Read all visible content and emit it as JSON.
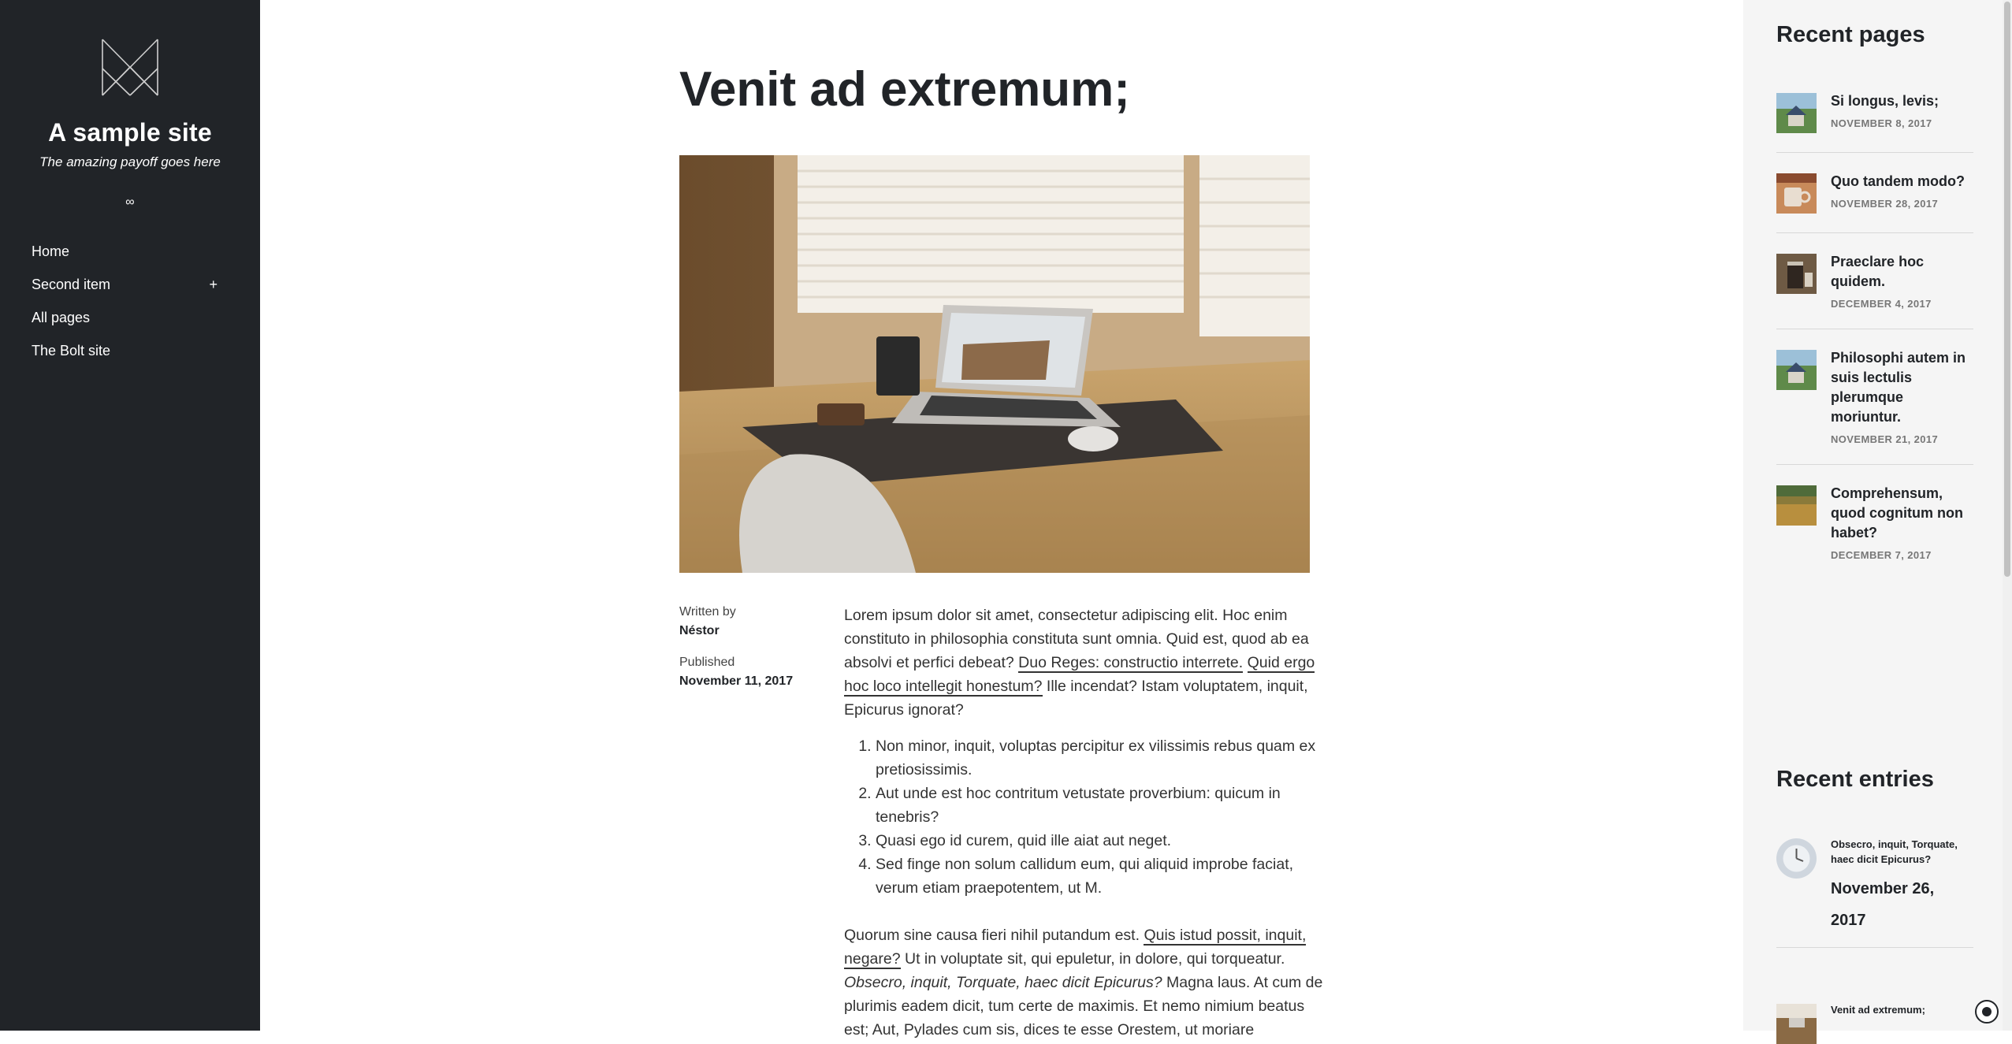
{
  "sidebar": {
    "site_title": "A sample site",
    "payoff": "The amazing payoff goes here",
    "separator": "∞",
    "logo_icon": "monogram-logo",
    "nav": [
      {
        "label": "Home"
      },
      {
        "label": "Second item",
        "expand": "+"
      },
      {
        "label": "All pages"
      },
      {
        "label": "The Bolt site"
      }
    ]
  },
  "article": {
    "title": "Venit ad extremum;",
    "image": "desk-laptop-photo",
    "written_by_label": "Written by",
    "author": "Néstor",
    "published_label": "Published",
    "published_date": "November 11, 2017",
    "p1_text1": "Lorem ipsum dolor sit amet, consectetur adipiscing elit. Hoc enim constituto in philosophia constituta sunt omnia. Quid est, quod ab ea absolvi et perfici debeat? ",
    "p1_link1": "Duo Reges: constructio interrete.",
    "p1_link2": "Quid ergo hoc loco intellegit honestum?",
    "p1_text2": " Ille incendat? Istam voluptatem, inquit, Epicurus ignorat?",
    "list": [
      "Non minor, inquit, voluptas percipitur ex vilissimis rebus quam ex pretiosissimis.",
      "Aut unde est hoc contritum vetustate proverbium: quicum in tenebris?",
      "Quasi ego id curem, quid ille aiat aut neget.",
      "Sed finge non solum callidum eum, qui aliquid improbe faciat, verum etiam praepotentem, ut M."
    ],
    "p2_text1": "Quorum sine causa fieri nihil putandum est. ",
    "p2_link1": "Quis istud possit, inquit, negare?",
    "p2_text2": " Ut in voluptate sit, qui epuletur, in dolore, qui torqueatur. ",
    "p2_italic": "Obsecro, inquit, Torquate, haec dicit Epicurus?",
    "p2_text3": " Magna laus. At cum de plurimis eadem dicit, tum certe de maximis. Et nemo nimium beatus est; Aut, Pylades cum sis, dices te esse Orestem, ut moriare"
  },
  "recent_pages": {
    "heading": "Recent pages",
    "items": [
      {
        "title": "Si longus, levis;",
        "date": "November 8, 2017",
        "thumb": "house-thumb"
      },
      {
        "title": "Quo tandem modo?",
        "date": "November 28, 2017",
        "thumb": "mug-thumb"
      },
      {
        "title": "Praeclare hoc quidem.",
        "date": "December 4, 2017",
        "thumb": "coffee-press-thumb"
      },
      {
        "title": "Philosophi autem in suis lectulis plerumque moriuntur.",
        "date": "November 21, 2017",
        "thumb": "house-thumb"
      },
      {
        "title": "Comprehensum, quod cognitum non habet?",
        "date": "December 7, 2017",
        "thumb": "wheat-field-thumb"
      }
    ]
  },
  "recent_entries": {
    "heading": "Recent entries",
    "items": [
      {
        "title": "Obsecro, inquit, Torquate, haec dicit Epicurus?",
        "date": "November 26, 2017",
        "thumb": "clock-thumb"
      },
      {
        "title": "Venit ad extremum;",
        "thumb": "desk-thumb"
      }
    ]
  },
  "colors": {
    "sidebar_bg": "#212428",
    "rightbar_bg": "#f5f5f5",
    "text": "#333333",
    "heading": "#212428"
  }
}
